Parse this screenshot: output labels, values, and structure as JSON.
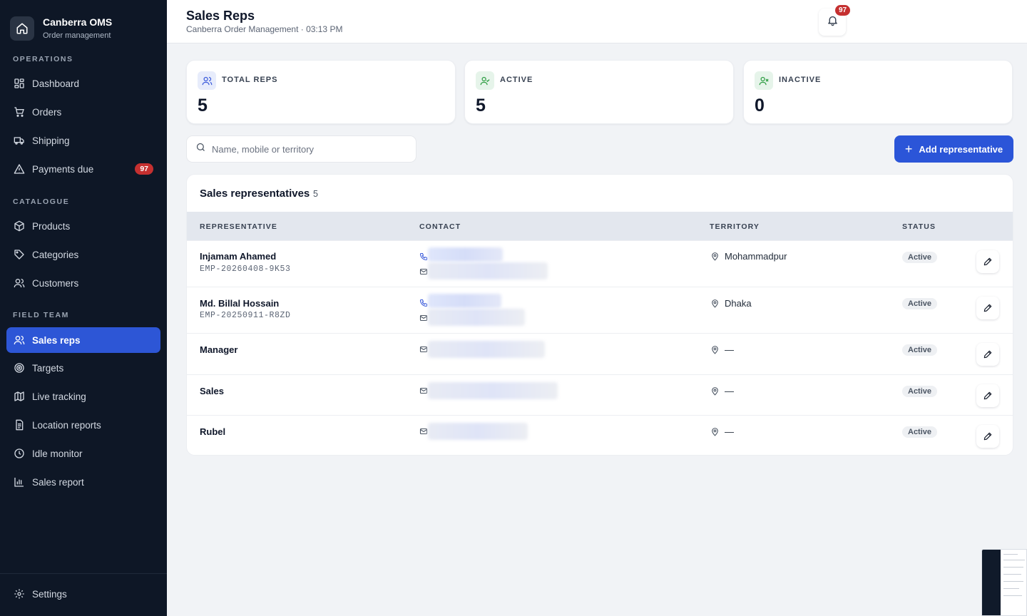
{
  "app": {
    "name": "Canberra OMS",
    "subtitle": "Order management"
  },
  "sidebar": {
    "sections": [
      {
        "label": "OPERATIONS"
      },
      {
        "label": "CATALOGUE"
      },
      {
        "label": "FIELD TEAM"
      }
    ],
    "items": [
      {
        "label": "Dashboard",
        "icon": "dashboard-icon"
      },
      {
        "label": "Orders",
        "icon": "cart-icon"
      },
      {
        "label": "Shipping",
        "icon": "truck-icon"
      },
      {
        "label": "Payments due",
        "icon": "warning-icon",
        "badge": "97"
      },
      {
        "label": "Products",
        "icon": "package-icon"
      },
      {
        "label": "Categories",
        "icon": "tag-icon"
      },
      {
        "label": "Customers",
        "icon": "users-icon"
      },
      {
        "label": "Sales reps",
        "icon": "users-icon",
        "active": true
      },
      {
        "label": "Targets",
        "icon": "target-icon"
      },
      {
        "label": "Live tracking",
        "icon": "map-icon"
      },
      {
        "label": "Location reports",
        "icon": "document-icon"
      },
      {
        "label": "Idle monitor",
        "icon": "clock-icon"
      },
      {
        "label": "Sales report",
        "icon": "bar-chart-icon"
      }
    ],
    "settings_label": "Settings"
  },
  "header": {
    "title": "Sales Reps",
    "subtitle": "Canberra Order Management · 03:13 PM",
    "notification_count": "97"
  },
  "stats": [
    {
      "label": "TOTAL REPS",
      "value": "5",
      "color": "#3b5bdb"
    },
    {
      "label": "ACTIVE",
      "value": "5",
      "color": "#2f9e44"
    },
    {
      "label": "INACTIVE",
      "value": "0",
      "color": "#2f9e44"
    }
  ],
  "search": {
    "placeholder": "Name, mobile or territory",
    "value": ""
  },
  "add_button_label": "Add representative",
  "table": {
    "title": "Sales representatives",
    "count": "5",
    "columns": [
      "REPRESENTATIVE",
      "CONTACT",
      "TERRITORY",
      "STATUS"
    ],
    "rows": [
      {
        "name": "Injamam Ahamed",
        "id": "EMP-20260408-9K53",
        "territory": "Mohammadpur",
        "status": "Active"
      },
      {
        "name": "Md. Billal Hossain",
        "id": "EMP-20250911-R8ZD",
        "territory": "Dhaka",
        "status": "Active"
      },
      {
        "name": "Manager",
        "id": "",
        "territory": "—",
        "status": "Active"
      },
      {
        "name": "Sales",
        "id": "",
        "territory": "—",
        "status": "Active"
      },
      {
        "name": "Rubel",
        "id": "",
        "territory": "—",
        "status": "Active"
      }
    ]
  },
  "colors": {
    "sidebar_bg": "#0e1726",
    "accent": "#2b55d8",
    "badge": "#c53030"
  }
}
